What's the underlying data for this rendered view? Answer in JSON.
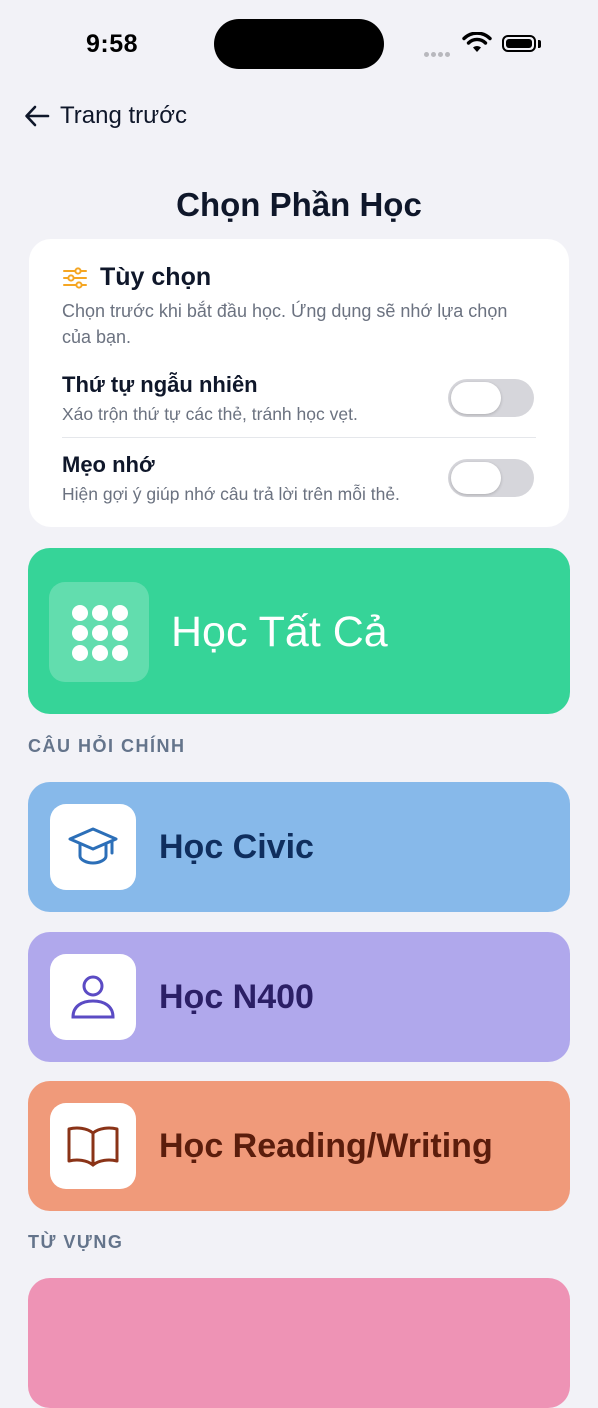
{
  "status": {
    "time": "9:58"
  },
  "nav": {
    "back_label": "Trang trước"
  },
  "page": {
    "title": "Chọn Phần Học"
  },
  "options": {
    "title": "Tùy chọn",
    "description": "Chọn trước khi bắt đầu học. Ứng dụng sẽ nhớ lựa chọn của bạn.",
    "items": [
      {
        "title": "Thứ tự ngẫu nhiên",
        "subtitle": "Xáo trộn thứ tự các thẻ, tránh học vẹt.",
        "enabled": false
      },
      {
        "title": "Mẹo nhớ",
        "subtitle": "Hiện gợi ý giúp nhớ câu trả lời trên mỗi thẻ.",
        "enabled": false
      }
    ]
  },
  "study_all": {
    "label": "Học Tất Cả",
    "color": "#36d498"
  },
  "sections": {
    "main_questions": "CÂU HỎI CHÍNH",
    "vocabulary": "TỪ VỰNG"
  },
  "study_cards": [
    {
      "label": "Học Civic",
      "icon": "graduation-cap-icon",
      "bg": "#87b9ea",
      "fg": "#0f2e5e"
    },
    {
      "label": "Học N400",
      "icon": "person-icon",
      "bg": "#b0a8ec",
      "fg": "#2b1f66"
    },
    {
      "label": "Học Reading/Writing",
      "icon": "open-book-icon",
      "bg": "#f09a7a",
      "fg": "#5b1d0c"
    }
  ],
  "vocab_card": {
    "bg": "#ee93b5"
  }
}
